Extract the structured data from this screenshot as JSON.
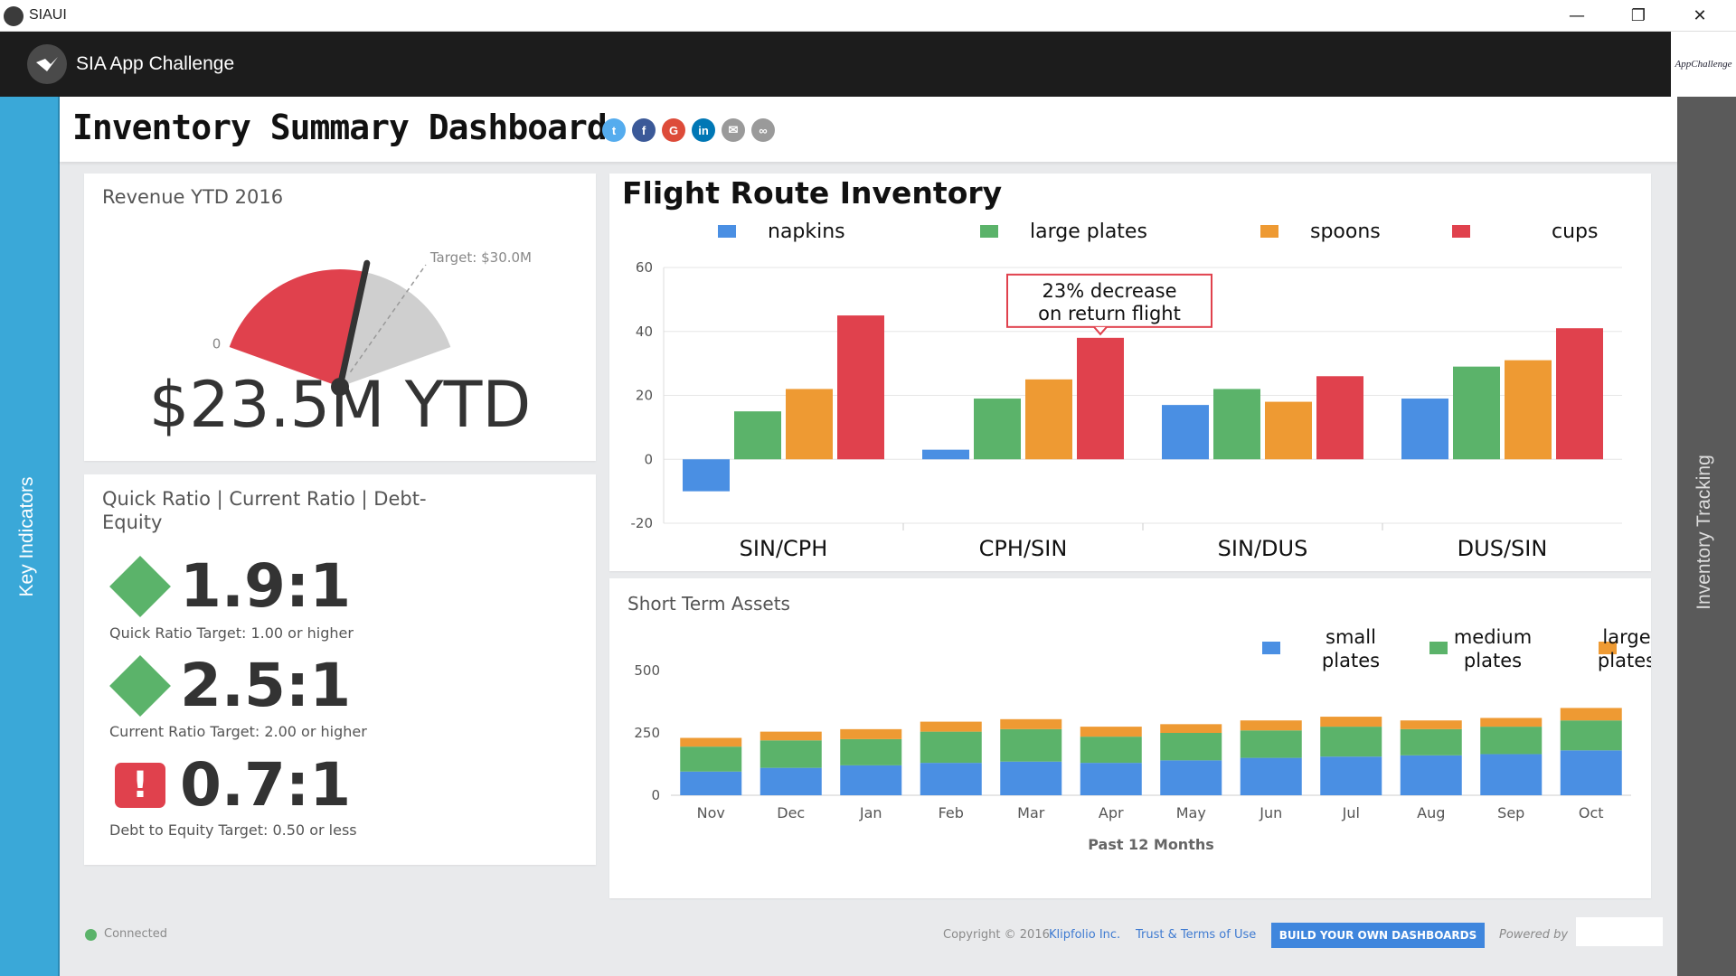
{
  "window": {
    "title": "SIAUI"
  },
  "app": {
    "title": "SIA App Challenge",
    "brand_text": "AppChallenge"
  },
  "sidebars": {
    "left_label": "Key Indicators",
    "right_label": "Inventory Tracking"
  },
  "dashboard": {
    "title": "Inventory Summary Dashboard"
  },
  "share_icons": [
    "twitter-icon",
    "facebook-icon",
    "google-plus-icon",
    "linkedin-icon",
    "email-icon",
    "link-icon"
  ],
  "revenue": {
    "title": "Revenue YTD 2016",
    "value_text": "$23.5M YTD",
    "min_label": "0",
    "target_label": "Target: $30.0M",
    "value": 23.5,
    "target": 30.0,
    "max": 40.0
  },
  "ratios": {
    "title": "Quick Ratio | Current Ratio | Debt-Equity",
    "items": [
      {
        "value": "1.9:1",
        "target": "Quick Ratio Target: 1.00 or higher",
        "status": "good"
      },
      {
        "value": "2.5:1",
        "target": "Current Ratio Target: 2.00 or higher",
        "status": "good"
      },
      {
        "value": "0.7:1",
        "target": "Debt to Equity Target: 0.50 or less",
        "status": "alert",
        "alert_symbol": "!"
      }
    ]
  },
  "colors": {
    "blue": "#4a8fe3",
    "green": "#5bb36a",
    "orange": "#ee9a33",
    "red": "#e0414d",
    "gauge_red": "#e0414d",
    "gauge_gray": "#cfcfcf"
  },
  "chart_data": [
    {
      "type": "bar",
      "title": "Flight Route Inventory",
      "categories": [
        "SIN/CPH",
        "CPH/SIN",
        "SIN/DUS",
        "DUS/SIN"
      ],
      "series": [
        {
          "name": "napkins",
          "values": [
            -10,
            3,
            17,
            19
          ]
        },
        {
          "name": "large plates",
          "values": [
            15,
            19,
            22,
            29
          ]
        },
        {
          "name": "spoons",
          "values": [
            22,
            25,
            18,
            31
          ]
        },
        {
          "name": "cups",
          "values": [
            45,
            38,
            26,
            41
          ]
        }
      ],
      "ylim": [
        -20,
        60
      ],
      "yticks": [
        -20,
        0,
        20,
        40,
        60
      ],
      "annotation": {
        "text_line1": "23% decrease",
        "text_line2": "on return flight",
        "category": "CPH/SIN",
        "series": "cups"
      },
      "grid": true,
      "legend": "top"
    },
    {
      "type": "bar",
      "stacked": true,
      "title": "Short Term Assets",
      "xlabel": "Past 12 Months",
      "categories": [
        "Nov",
        "Dec",
        "Jan",
        "Feb",
        "Mar",
        "Apr",
        "May",
        "Jun",
        "Jul",
        "Aug",
        "Sep",
        "Oct"
      ],
      "series": [
        {
          "name": "small plates",
          "legend_line1": "small",
          "legend_line2": "plates",
          "values": [
            95,
            110,
            120,
            130,
            135,
            130,
            140,
            150,
            155,
            160,
            165,
            180
          ]
        },
        {
          "name": "medium plates",
          "legend_line1": "medium",
          "legend_line2": "plates",
          "values": [
            100,
            110,
            105,
            125,
            130,
            105,
            110,
            110,
            120,
            105,
            110,
            120
          ]
        },
        {
          "name": "large plates",
          "legend_line1": "large",
          "legend_line2": "plates",
          "values": [
            35,
            35,
            40,
            40,
            40,
            40,
            35,
            40,
            40,
            35,
            35,
            50
          ]
        }
      ],
      "ylim": [
        0,
        500
      ],
      "yticks": [
        0,
        250,
        500
      ],
      "grid": false,
      "legend": "top-right"
    }
  ],
  "footer": {
    "status": "Connected",
    "copyright": "Copyright © 2016",
    "company": "Klipfolio Inc.",
    "terms": "Trust & Terms of Use",
    "cta": "BUILD YOUR OWN DASHBOARDS",
    "powered": "Powered by"
  }
}
